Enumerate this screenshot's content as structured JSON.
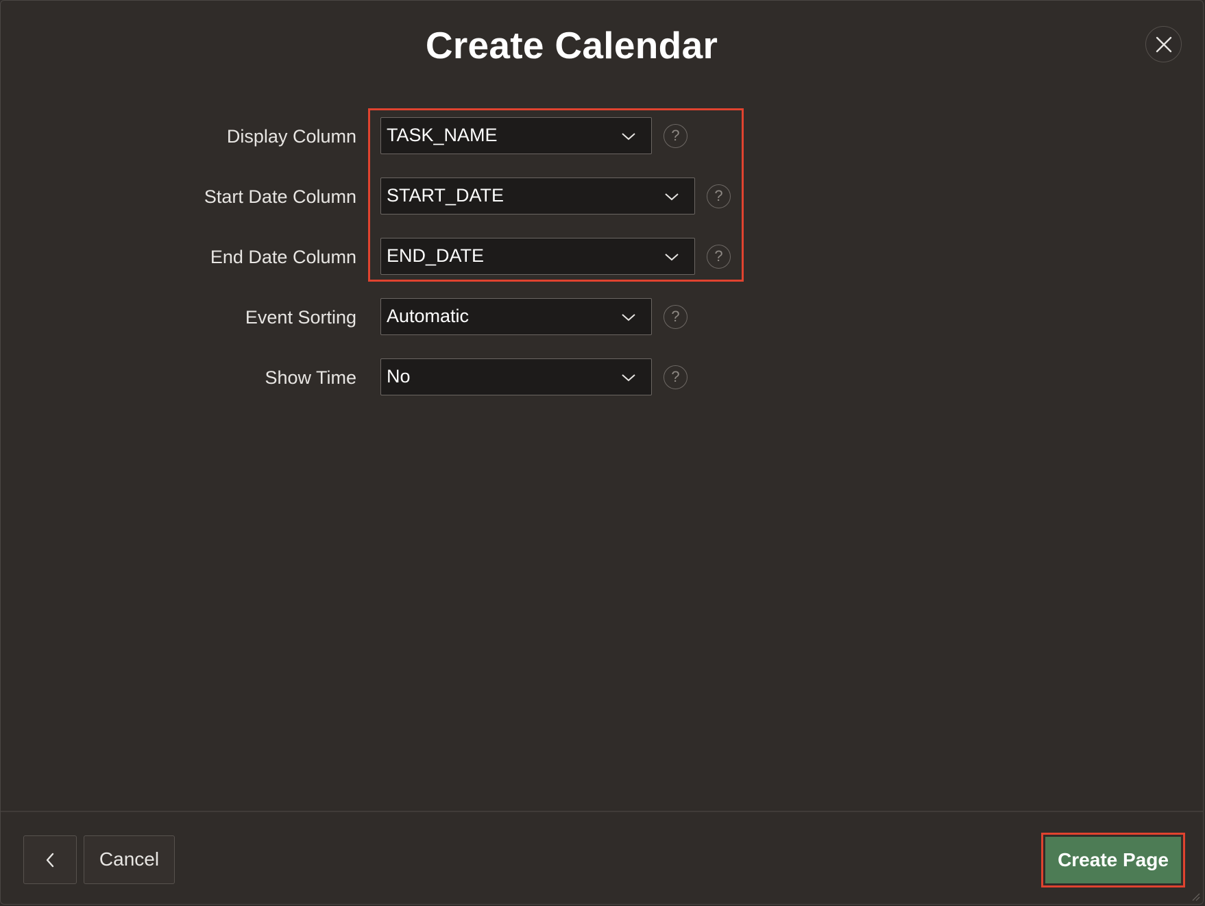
{
  "dialog": {
    "title": "Create Calendar",
    "close_icon": "close-icon"
  },
  "fields": [
    {
      "label": "Display Column",
      "value": "TASK_NAME",
      "help": "?"
    },
    {
      "label": "Start Date Column",
      "value": "START_DATE",
      "help": "?"
    },
    {
      "label": "End Date Column",
      "value": "END_DATE",
      "help": "?"
    },
    {
      "label": "Event Sorting",
      "value": "Automatic",
      "help": "?"
    },
    {
      "label": "Show Time",
      "value": "No",
      "help": "?"
    }
  ],
  "footer": {
    "back_icon": "chevron-left-icon",
    "cancel_label": "Cancel",
    "create_label": "Create Page"
  },
  "colors": {
    "background": "#302c29",
    "highlight": "#e0432f",
    "primary_button": "#4d7c55"
  }
}
